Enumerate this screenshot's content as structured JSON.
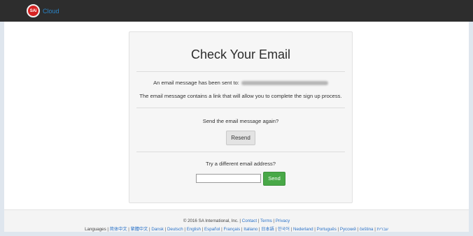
{
  "header": {
    "logo_text": "SAi",
    "brand": "Cloud"
  },
  "card": {
    "title": "Check Your Email",
    "sent_prefix": "An email message has been sent to:",
    "message": "The email message contains a link that will allow you to complete the sign up process.",
    "resend_question": "Send the email message again?",
    "resend_label": "Resend",
    "try_question": "Try a different email address?",
    "email_value": "",
    "send_label": "Send"
  },
  "footer": {
    "copyright": "© 2016 SA International, Inc. |",
    "contact": "Contact",
    "terms": "Terms",
    "privacy": "Privacy",
    "languages_label": "Languages |",
    "languages": [
      "简体中文",
      "繁體中文",
      "Dansk",
      "Deutsch",
      "English",
      "Español",
      "Français",
      "Italiano",
      "日本語",
      "한국어",
      "Nederland",
      "Português",
      "Русский",
      "čeština",
      "עברית"
    ]
  },
  "colors": {
    "topbar": "#2d2d2d",
    "logo_red": "#d62222",
    "brand_blue": "#2a84c7",
    "send_green": "#48a847",
    "link_blue": "#2a72c8"
  }
}
